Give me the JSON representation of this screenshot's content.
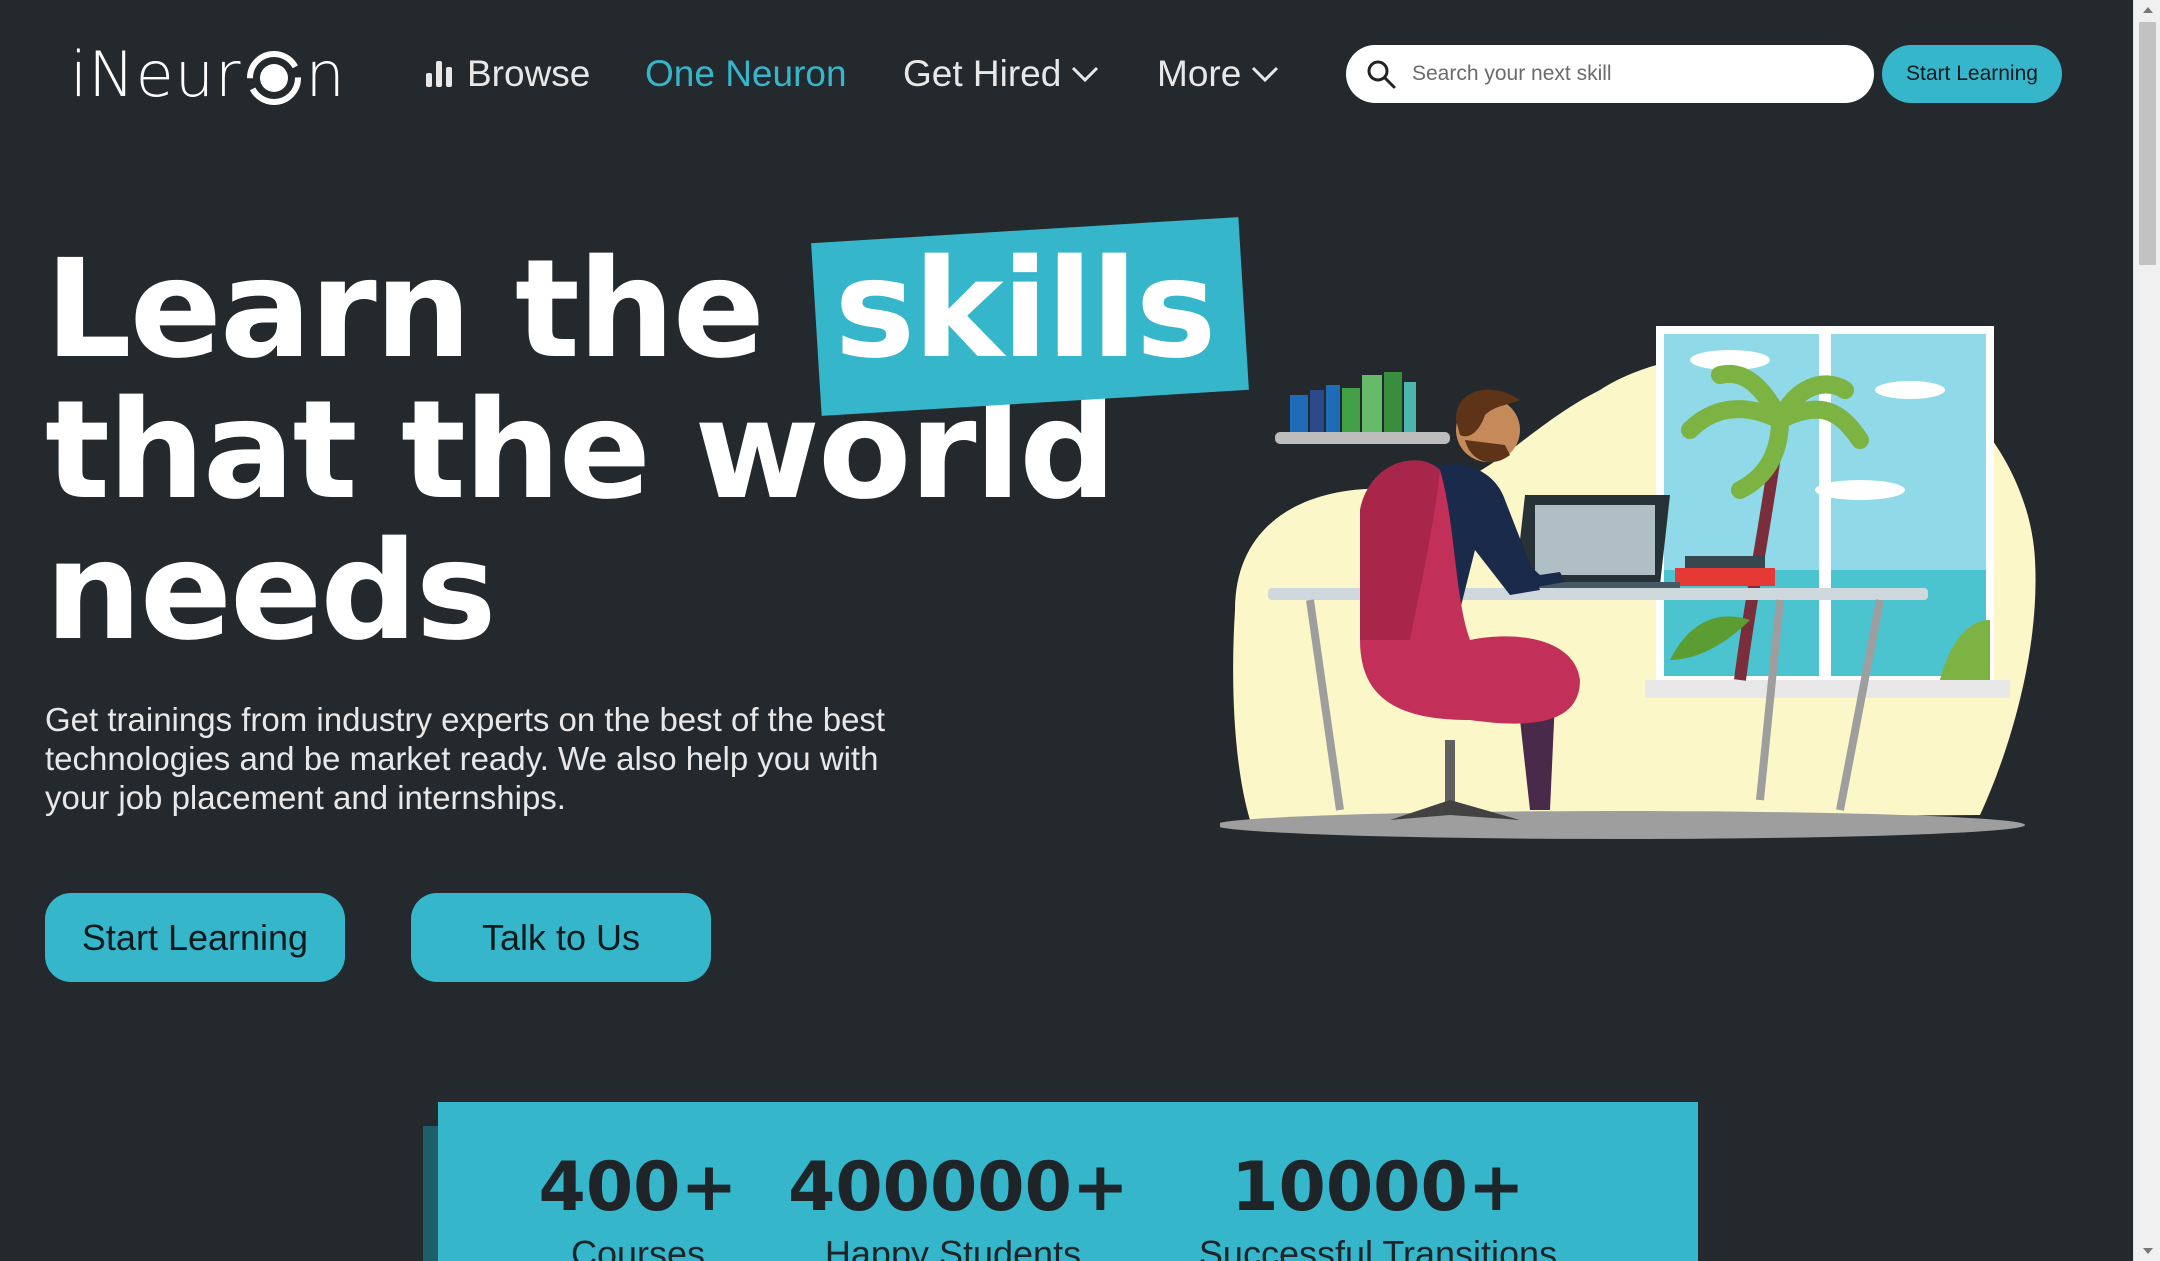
{
  "brand": {
    "logo_text_before": "iNeur",
    "logo_text_after": "n",
    "accent": "#35b6cb",
    "background": "#24292e"
  },
  "nav": {
    "browse": "Browse",
    "one_neuron": "One Neuron",
    "get_hired": "Get Hired",
    "more": "More",
    "search_placeholder": "Search your next skill",
    "start_learning": "Start Learning"
  },
  "hero": {
    "title_part1": "Learn the",
    "title_highlight": "skills",
    "title_line2": "that the world",
    "title_line3": "needs",
    "subtitle": "Get trainings from industry experts on the best of the best technologies and be market ready. We also help you with your job placement and internships.",
    "btn_start": "Start Learning",
    "btn_talk": "Talk to Us"
  },
  "stats": [
    {
      "value": "400+",
      "label": "Courses"
    },
    {
      "value": "400000+",
      "label": "Happy Students"
    },
    {
      "value": "10000+",
      "label": "Successful Transitions"
    }
  ],
  "icons": {
    "browse": "bar-chart-icon",
    "dropdown": "chevron-down-icon",
    "search": "search-icon"
  }
}
